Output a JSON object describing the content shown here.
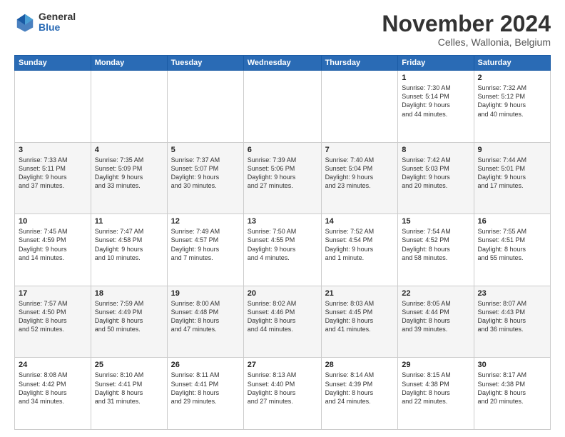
{
  "header": {
    "logo_general": "General",
    "logo_blue": "Blue",
    "title": "November 2024",
    "subtitle": "Celles, Wallonia, Belgium"
  },
  "calendar": {
    "days_of_week": [
      "Sunday",
      "Monday",
      "Tuesday",
      "Wednesday",
      "Thursday",
      "Friday",
      "Saturday"
    ],
    "weeks": [
      [
        {
          "day": "",
          "info": ""
        },
        {
          "day": "",
          "info": ""
        },
        {
          "day": "",
          "info": ""
        },
        {
          "day": "",
          "info": ""
        },
        {
          "day": "",
          "info": ""
        },
        {
          "day": "1",
          "info": "Sunrise: 7:30 AM\nSunset: 5:14 PM\nDaylight: 9 hours\nand 44 minutes."
        },
        {
          "day": "2",
          "info": "Sunrise: 7:32 AM\nSunset: 5:12 PM\nDaylight: 9 hours\nand 40 minutes."
        }
      ],
      [
        {
          "day": "3",
          "info": "Sunrise: 7:33 AM\nSunset: 5:11 PM\nDaylight: 9 hours\nand 37 minutes."
        },
        {
          "day": "4",
          "info": "Sunrise: 7:35 AM\nSunset: 5:09 PM\nDaylight: 9 hours\nand 33 minutes."
        },
        {
          "day": "5",
          "info": "Sunrise: 7:37 AM\nSunset: 5:07 PM\nDaylight: 9 hours\nand 30 minutes."
        },
        {
          "day": "6",
          "info": "Sunrise: 7:39 AM\nSunset: 5:06 PM\nDaylight: 9 hours\nand 27 minutes."
        },
        {
          "day": "7",
          "info": "Sunrise: 7:40 AM\nSunset: 5:04 PM\nDaylight: 9 hours\nand 23 minutes."
        },
        {
          "day": "8",
          "info": "Sunrise: 7:42 AM\nSunset: 5:03 PM\nDaylight: 9 hours\nand 20 minutes."
        },
        {
          "day": "9",
          "info": "Sunrise: 7:44 AM\nSunset: 5:01 PM\nDaylight: 9 hours\nand 17 minutes."
        }
      ],
      [
        {
          "day": "10",
          "info": "Sunrise: 7:45 AM\nSunset: 4:59 PM\nDaylight: 9 hours\nand 14 minutes."
        },
        {
          "day": "11",
          "info": "Sunrise: 7:47 AM\nSunset: 4:58 PM\nDaylight: 9 hours\nand 10 minutes."
        },
        {
          "day": "12",
          "info": "Sunrise: 7:49 AM\nSunset: 4:57 PM\nDaylight: 9 hours\nand 7 minutes."
        },
        {
          "day": "13",
          "info": "Sunrise: 7:50 AM\nSunset: 4:55 PM\nDaylight: 9 hours\nand 4 minutes."
        },
        {
          "day": "14",
          "info": "Sunrise: 7:52 AM\nSunset: 4:54 PM\nDaylight: 9 hours\nand 1 minute."
        },
        {
          "day": "15",
          "info": "Sunrise: 7:54 AM\nSunset: 4:52 PM\nDaylight: 8 hours\nand 58 minutes."
        },
        {
          "day": "16",
          "info": "Sunrise: 7:55 AM\nSunset: 4:51 PM\nDaylight: 8 hours\nand 55 minutes."
        }
      ],
      [
        {
          "day": "17",
          "info": "Sunrise: 7:57 AM\nSunset: 4:50 PM\nDaylight: 8 hours\nand 52 minutes."
        },
        {
          "day": "18",
          "info": "Sunrise: 7:59 AM\nSunset: 4:49 PM\nDaylight: 8 hours\nand 50 minutes."
        },
        {
          "day": "19",
          "info": "Sunrise: 8:00 AM\nSunset: 4:48 PM\nDaylight: 8 hours\nand 47 minutes."
        },
        {
          "day": "20",
          "info": "Sunrise: 8:02 AM\nSunset: 4:46 PM\nDaylight: 8 hours\nand 44 minutes."
        },
        {
          "day": "21",
          "info": "Sunrise: 8:03 AM\nSunset: 4:45 PM\nDaylight: 8 hours\nand 41 minutes."
        },
        {
          "day": "22",
          "info": "Sunrise: 8:05 AM\nSunset: 4:44 PM\nDaylight: 8 hours\nand 39 minutes."
        },
        {
          "day": "23",
          "info": "Sunrise: 8:07 AM\nSunset: 4:43 PM\nDaylight: 8 hours\nand 36 minutes."
        }
      ],
      [
        {
          "day": "24",
          "info": "Sunrise: 8:08 AM\nSunset: 4:42 PM\nDaylight: 8 hours\nand 34 minutes."
        },
        {
          "day": "25",
          "info": "Sunrise: 8:10 AM\nSunset: 4:41 PM\nDaylight: 8 hours\nand 31 minutes."
        },
        {
          "day": "26",
          "info": "Sunrise: 8:11 AM\nSunset: 4:41 PM\nDaylight: 8 hours\nand 29 minutes."
        },
        {
          "day": "27",
          "info": "Sunrise: 8:13 AM\nSunset: 4:40 PM\nDaylight: 8 hours\nand 27 minutes."
        },
        {
          "day": "28",
          "info": "Sunrise: 8:14 AM\nSunset: 4:39 PM\nDaylight: 8 hours\nand 24 minutes."
        },
        {
          "day": "29",
          "info": "Sunrise: 8:15 AM\nSunset: 4:38 PM\nDaylight: 8 hours\nand 22 minutes."
        },
        {
          "day": "30",
          "info": "Sunrise: 8:17 AM\nSunset: 4:38 PM\nDaylight: 8 hours\nand 20 minutes."
        }
      ]
    ]
  }
}
